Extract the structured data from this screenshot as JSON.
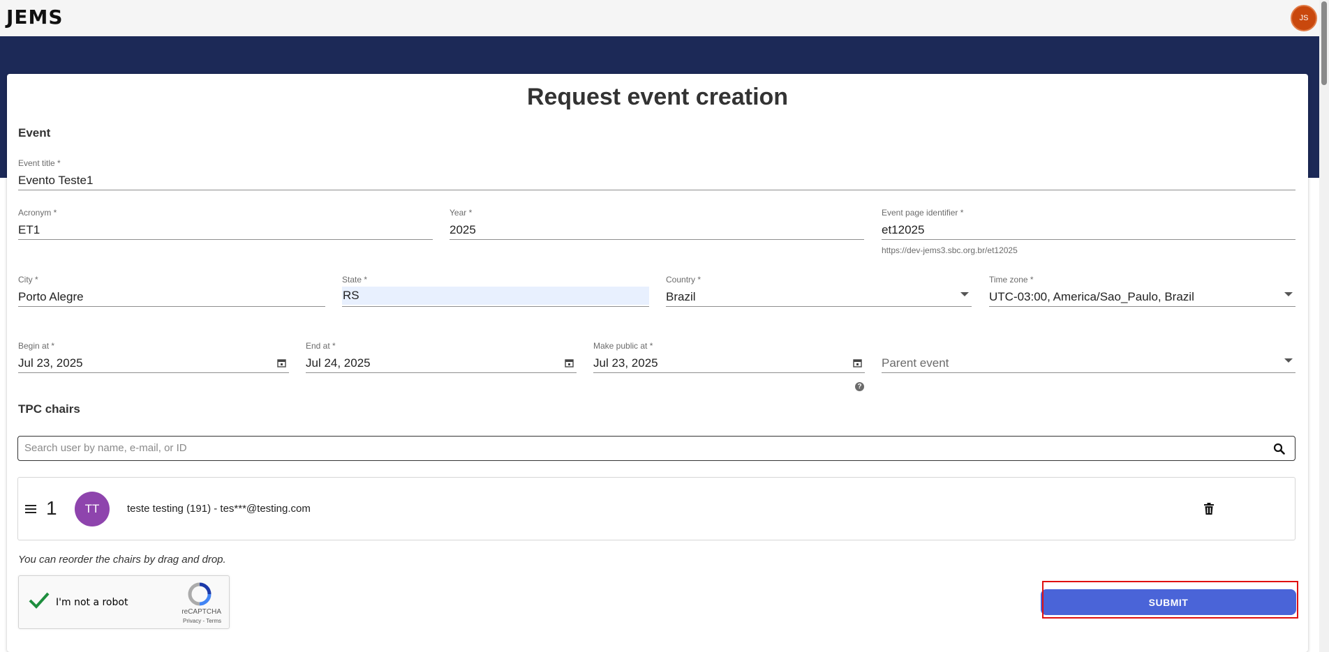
{
  "app": {
    "logo_text": "JEMS",
    "user_initials": "JS"
  },
  "page": {
    "title": "Request event creation"
  },
  "event_section": {
    "heading": "Event",
    "event_title": {
      "label": "Event title *",
      "value": "Evento Teste1"
    },
    "acronym": {
      "label": "Acronym *",
      "value": "ET1"
    },
    "year": {
      "label": "Year *",
      "value": "2025"
    },
    "page_identifier": {
      "label": "Event page identifier *",
      "value": "et12025",
      "hint": "https://dev-jems3.sbc.org.br/et12025"
    },
    "city": {
      "label": "City *",
      "value": "Porto Alegre"
    },
    "state": {
      "label": "State *",
      "value": "RS"
    },
    "country": {
      "label": "Country *",
      "value": "Brazil"
    },
    "timezone": {
      "label": "Time zone *",
      "value": "UTC-03:00, America/Sao_Paulo, Brazil"
    },
    "begin_at": {
      "label": "Begin at *",
      "value": "Jul 23, 2025"
    },
    "end_at": {
      "label": "End at *",
      "value": "Jul 24, 2025"
    },
    "make_public_at": {
      "label": "Make public at *",
      "value": "Jul 23, 2025"
    },
    "parent_event": {
      "placeholder": "Parent event"
    }
  },
  "tpc_section": {
    "heading": "TPC chairs",
    "search_placeholder": "Search user by name, e-mail, or ID",
    "chairs": [
      {
        "position": "1",
        "initials": "TT",
        "text": "teste testing (191) - tes***@testing.com"
      }
    ],
    "reorder_note": "You can reorder the chairs by drag and drop."
  },
  "recaptcha": {
    "label": "I'm not a robot",
    "brand": "reCAPTCHA",
    "links": "Privacy - Terms"
  },
  "actions": {
    "submit_label": "SUBMIT"
  },
  "colors": {
    "banner": "#1c2957",
    "submit": "#4a64d8",
    "avatar_user": "#c9480d",
    "avatar_chair": "#8e44ad",
    "highlight": "#e01010"
  }
}
